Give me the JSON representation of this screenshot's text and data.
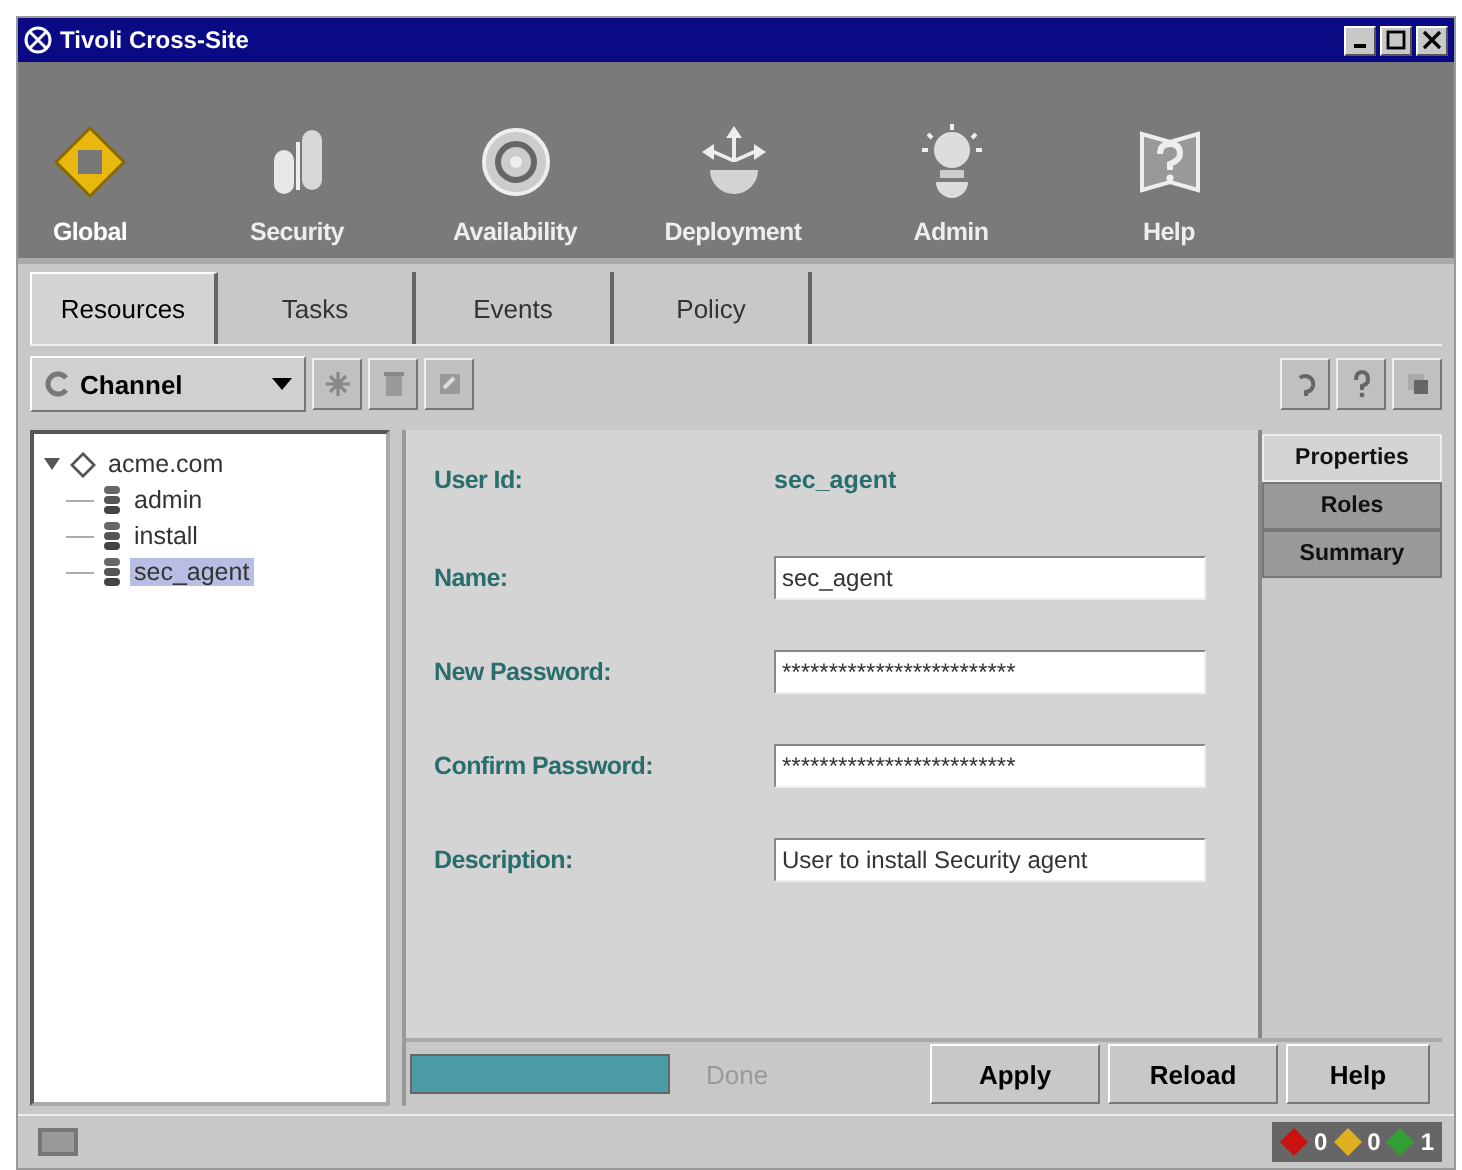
{
  "window": {
    "title": "Tivoli Cross-Site"
  },
  "toolbar": [
    {
      "label": "Global",
      "selected": true,
      "kind": "global"
    },
    {
      "label": "Security",
      "selected": false,
      "kind": "security"
    },
    {
      "label": "Availability",
      "selected": false,
      "kind": "availability"
    },
    {
      "label": "Deployment",
      "selected": false,
      "kind": "deployment"
    },
    {
      "label": "Admin",
      "selected": false,
      "kind": "admin"
    },
    {
      "label": "Help",
      "selected": false,
      "kind": "help"
    }
  ],
  "tabs": [
    {
      "label": "Resources",
      "selected": true
    },
    {
      "label": "Tasks",
      "selected": false
    },
    {
      "label": "Events",
      "selected": false
    },
    {
      "label": "Policy",
      "selected": false
    }
  ],
  "channel_dropdown": {
    "value": "Channel"
  },
  "tree": [
    {
      "label": "acme.com",
      "expanded": true,
      "selected": false,
      "children": [
        {
          "label": "admin",
          "selected": false
        },
        {
          "label": "install",
          "selected": false
        },
        {
          "label": "sec_agent",
          "selected": true
        }
      ]
    }
  ],
  "form": {
    "user_id_label": "User Id:",
    "user_id": "sec_agent",
    "fields": [
      {
        "label": "Name:",
        "value": "sec_agent"
      },
      {
        "label": "New Password:",
        "value": "*************************"
      },
      {
        "label": "Confirm Password:",
        "value": "*************************"
      },
      {
        "label": "Description:",
        "value": "User to install Security agent"
      }
    ]
  },
  "side_tabs": [
    {
      "label": "Properties",
      "selected": true
    },
    {
      "label": "Roles",
      "selected": false
    },
    {
      "label": "Summary",
      "selected": false
    }
  ],
  "progress": {
    "level": 1,
    "status": "Done"
  },
  "buttons": [
    "Apply",
    "Reload",
    "Help"
  ],
  "status_counts": [
    {
      "count": "0",
      "color": "#cc1111"
    },
    {
      "count": "0",
      "color": "#e0b020"
    },
    {
      "count": "1",
      "color": "#33a033"
    }
  ]
}
